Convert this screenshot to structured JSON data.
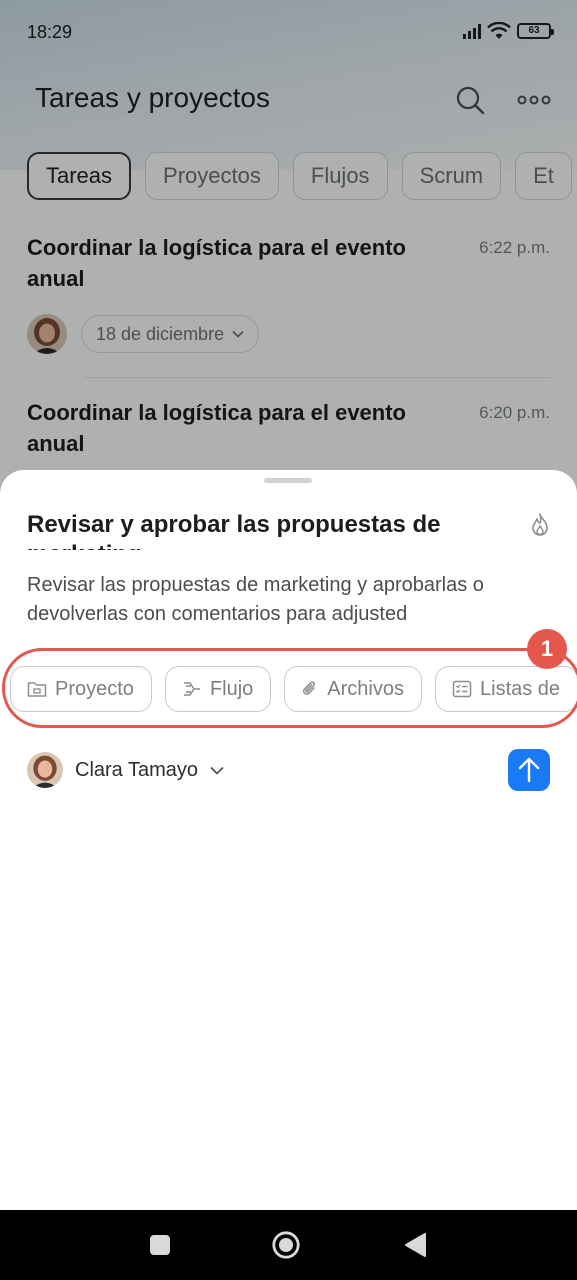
{
  "status_bar": {
    "time": "18:29",
    "battery": "63"
  },
  "header": {
    "title": "Tareas y proyectos",
    "icons": [
      "search-icon",
      "more-icon"
    ]
  },
  "tabs": [
    {
      "label": "Tareas",
      "active": true
    },
    {
      "label": "Proyectos",
      "active": false
    },
    {
      "label": "Flujos",
      "active": false
    },
    {
      "label": "Scrum",
      "active": false
    },
    {
      "label": "Et",
      "active": false
    }
  ],
  "tasks": [
    {
      "title": "Coordinar la logística para el evento anual",
      "time": "6:22 p.m.",
      "date": "18 de diciembre"
    },
    {
      "title": "Coordinar la logística para el evento anual",
      "time": "6:20 p.m."
    }
  ],
  "sheet": {
    "title": "Revisar y aprobar las propuestas de marketing",
    "description": "Revisar las propuestas de marketing y aprobarlas o devolverlas con comentarios para adjusted",
    "chips": [
      {
        "label": "Proyecto",
        "icon": "folder-icon"
      },
      {
        "label": "Flujo",
        "icon": "flow-icon"
      },
      {
        "label": "Archivos",
        "icon": "paperclip-icon"
      },
      {
        "label": "Listas de",
        "icon": "checklist-icon"
      }
    ],
    "highlight_badge": "1",
    "assignee": "Clara Tamayo"
  },
  "colors": {
    "accent": "#1a7af5",
    "highlight": "#e4574c"
  }
}
